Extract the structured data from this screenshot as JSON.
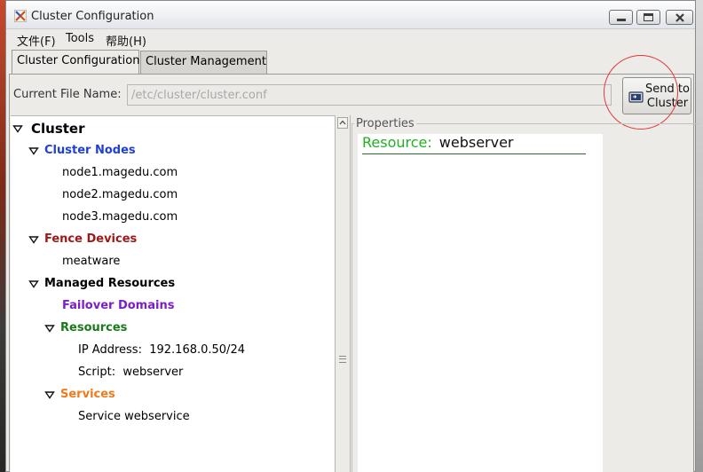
{
  "window": {
    "title": "Cluster Configuration"
  },
  "menu": {
    "items": [
      {
        "label": "文件(F)"
      },
      {
        "label": "Tools"
      },
      {
        "label": "帮助(H)"
      }
    ]
  },
  "tabs": [
    {
      "label": "Cluster Configuration",
      "active": true
    },
    {
      "label": "Cluster Management",
      "active": false
    }
  ],
  "file": {
    "label": "Current File Name:",
    "value": "/etc/cluster/cluster.conf"
  },
  "send_button": {
    "line1": "Send to",
    "line2": "Cluster"
  },
  "tree": {
    "root": "Cluster",
    "cluster_nodes": {
      "label": "Cluster Nodes",
      "color": "#1f3fd6",
      "items": [
        "node1.magedu.com",
        "node2.magedu.com",
        "node3.magedu.com"
      ]
    },
    "fence_devices": {
      "label": "Fence Devices",
      "color": "#a01818",
      "items": [
        "meatware"
      ]
    },
    "managed_resources": {
      "label": "Managed Resources",
      "failover_domains": {
        "label": "Failover Domains",
        "color": "#7a1fc8"
      },
      "resources": {
        "label": "Resources",
        "color": "#1a7a1a",
        "items": [
          "IP Address:  192.168.0.50/24",
          "Script:  webserver"
        ]
      },
      "services": {
        "label": "Services",
        "color": "#f07a1a",
        "items": [
          "Service webservice"
        ]
      }
    }
  },
  "properties": {
    "legend": "Properties",
    "resource_key": "Resource:",
    "resource_value": "webserver"
  }
}
